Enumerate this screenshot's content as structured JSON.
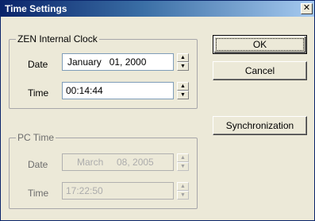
{
  "window": {
    "title": "Time Settings",
    "close_glyph": "✕"
  },
  "zen_clock": {
    "legend": "ZEN Internal Clock",
    "date_label": "Date",
    "date_value": "January   01, 2000",
    "time_label": "Time",
    "time_value": "00:14:44"
  },
  "pc_time": {
    "legend": "PC Time",
    "date_label": "Date",
    "date_value": "March     08, 2005",
    "time_label": "Time",
    "time_value": "17:22:50"
  },
  "buttons": {
    "ok": "OK",
    "cancel": "Cancel",
    "sync": "Synchronization"
  },
  "spin_glyphs": {
    "up": "▲",
    "down": "▼"
  }
}
